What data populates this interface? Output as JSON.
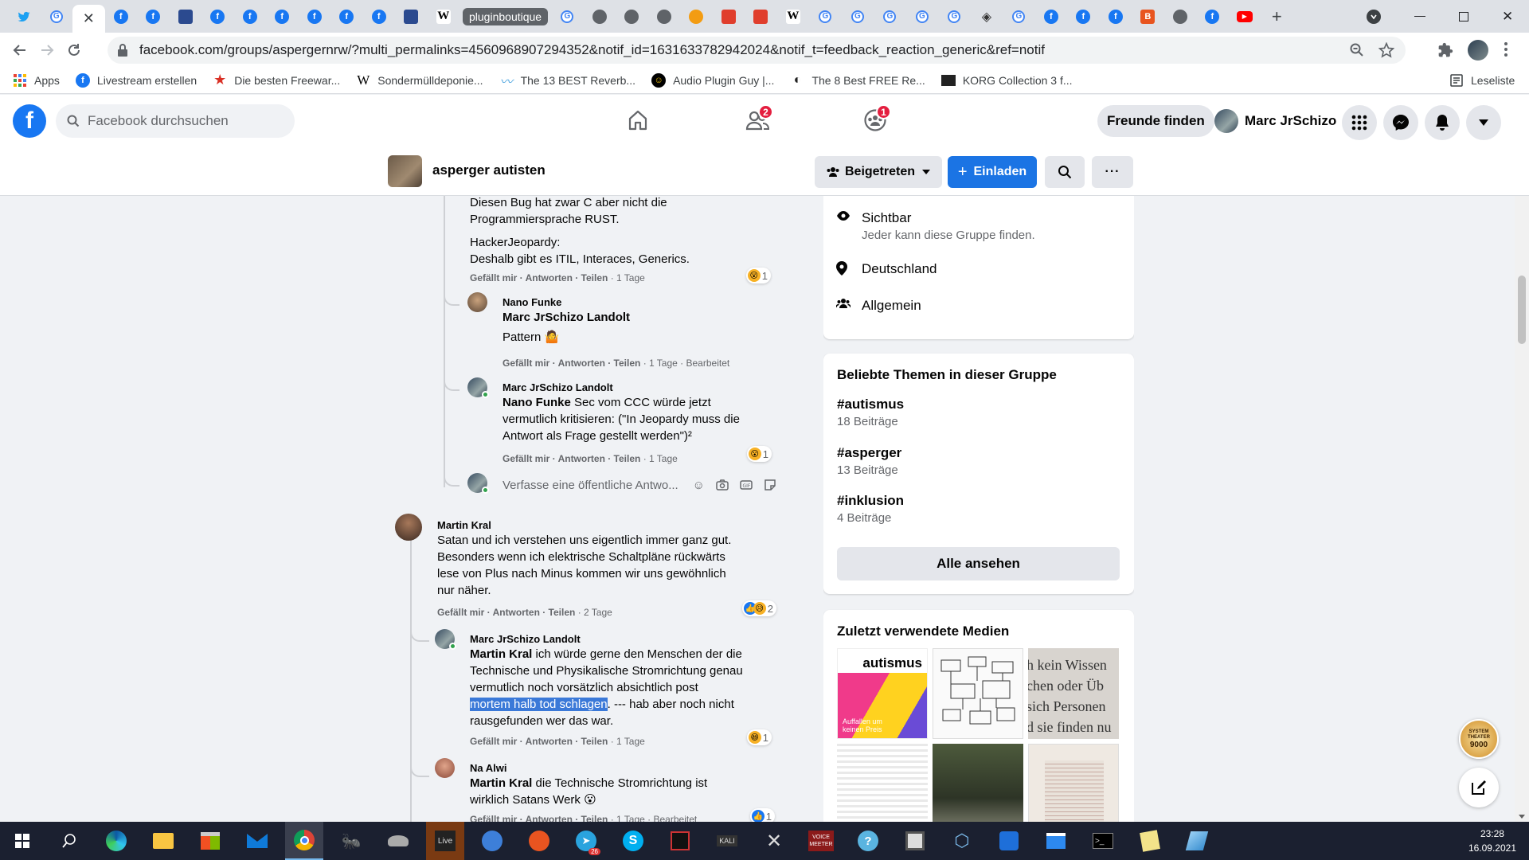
{
  "browser": {
    "tab_group_label": "pluginboutique",
    "url": "facebook.com/groups/aspergernrw/?multi_permalinks=4560968907294352&notif_id=1631633782942024&notif_t=feedback_reaction_generic&ref=notif",
    "bookmarks": [
      {
        "label": "Apps",
        "icon": "apps-grid-icon"
      },
      {
        "label": "Livestream erstellen",
        "icon": "facebook-icon"
      },
      {
        "label": "Die besten Freewar...",
        "icon": "star-icon"
      },
      {
        "label": "Sondermülldeponie...",
        "icon": "w-icon"
      },
      {
        "label": "The 13 BEST Reverb...",
        "icon": "wave-icon"
      },
      {
        "label": "Audio Plugin Guy |...",
        "icon": "plugin-guy-icon"
      },
      {
        "label": "The 8 Best FREE Re...",
        "icon": "moon-icon"
      },
      {
        "label": "KORG Collection 3 f...",
        "icon": "korg-icon"
      }
    ],
    "reading_list_label": "Leseliste"
  },
  "facebook": {
    "search_placeholder": "Facebook durchsuchen",
    "friends_badge": "2",
    "groups_badge": "1",
    "find_friends_label": "Freunde finden",
    "profile_name": "Marc JrSchizo"
  },
  "group": {
    "name": "asperger autisten",
    "joined_label": "Beigetreten",
    "invite_label": "Einladen"
  },
  "comments": {
    "c1": {
      "line1": "Diesen Bug hat zwar C aber nicht die",
      "line2": "Programmiersprache RUST.",
      "line3": "HackerJeopardy:",
      "line4": "Deshalb gibt es ITIL, Interaces, Generics.",
      "reaction_count": "1",
      "actions": "Gefällt mir · Antworten · Teilen",
      "time": "· 1 Tage"
    },
    "c2": {
      "author": "Nano Funke",
      "mention": "Marc JrSchizo Landolt",
      "text": "Pattern 🤷",
      "actions": "Gefällt mir · Antworten · Teilen",
      "time": "· 1 Tage · Bearbeitet"
    },
    "c3": {
      "author": "Marc JrSchizo Landolt",
      "mention": "Nano Funke",
      "line1": "Sec vom CCC würde jetzt",
      "line2": "vermutlich kritisieren: (\"In Jeopardy muss die",
      "line3": "Antwort als Frage gestellt werden\")²",
      "reaction_count": "1",
      "actions": "Gefällt mir · Antworten · Teilen",
      "time": "· 1 Tage"
    },
    "reply_placeholder": "Verfasse eine öffentliche Antwo...",
    "c4": {
      "author": "Martin Kral",
      "line1": "Satan und ich verstehen uns eigentlich immer ganz gut.",
      "line2": "Besonders wenn ich elektrische Schaltpläne rückwärts",
      "line3": "lese von Plus nach Minus kommen wir uns gewöhnlich",
      "line4": "nur näher.",
      "reaction_count": "2",
      "actions": "Gefällt mir · Antworten · Teilen",
      "time": "· 2 Tage"
    },
    "c5": {
      "author": "Marc JrSchizo Landolt",
      "mention": "Martin Kral",
      "line1": "ich würde gerne den Menschen der die",
      "line2": "Technische und Physikalische Stromrichtung genau",
      "line3": "vermutlich noch vorsätzlich absichtlich post",
      "selected": "mortem halb tod schlagen",
      "line4_rest": ". --- hab aber noch nicht",
      "line5": "rausgefunden wer das war.",
      "reaction_count": "1",
      "actions": "Gefällt mir · Antworten · Teilen",
      "time": "· 1 Tage"
    },
    "c6": {
      "author": "Na Alwi",
      "mention": "Martin Kral",
      "line1": "die Technische Stromrichtung ist",
      "line2": "wirklich Satans Werk 😮",
      "reaction_count": "1",
      "actions": "Gefällt mir · Antworten · Teilen",
      "time": "· 1 Tage · Bearbeitet"
    }
  },
  "sidebar": {
    "visible_title": "Sichtbar",
    "visible_desc": "Jeder kann diese Gruppe finden.",
    "location": "Deutschland",
    "category": "Allgemein",
    "topics_title": "Beliebte Themen in dieser Gruppe",
    "topics": [
      {
        "tag": "#autismus",
        "count": "18 Beiträge"
      },
      {
        "tag": "#asperger",
        "count": "13 Beiträge"
      },
      {
        "tag": "#inklusion",
        "count": "4 Beiträge"
      }
    ],
    "see_all": "Alle ansehen",
    "media_title": "Zuletzt verwendete Medien",
    "media1_title": "autismus",
    "media1_sub": "Auffallen um keinen Preis",
    "media3_text1": "h kein Wissen",
    "media3_text2": "chen oder Üb",
    "media3_text3": "sich Personen",
    "media3_text4": "d sie finden nu"
  },
  "floating": {
    "badge_line1": "SYSTEM",
    "badge_line2": "THEATER",
    "badge_line3": "9000"
  },
  "taskbar": {
    "clock_time": "23:28",
    "clock_date": "16.09.2021",
    "telegram_badge": "26",
    "live_label": "Live",
    "voicemeeter_label1": "VOICE",
    "voicemeeter_label2": "MEETER",
    "kali_label": "KALI"
  },
  "colors": {
    "facebook_blue": "#1877f2",
    "notification_red": "#e41e3f",
    "selection_blue": "#3b79d8",
    "taskbar": "#1b2030"
  }
}
